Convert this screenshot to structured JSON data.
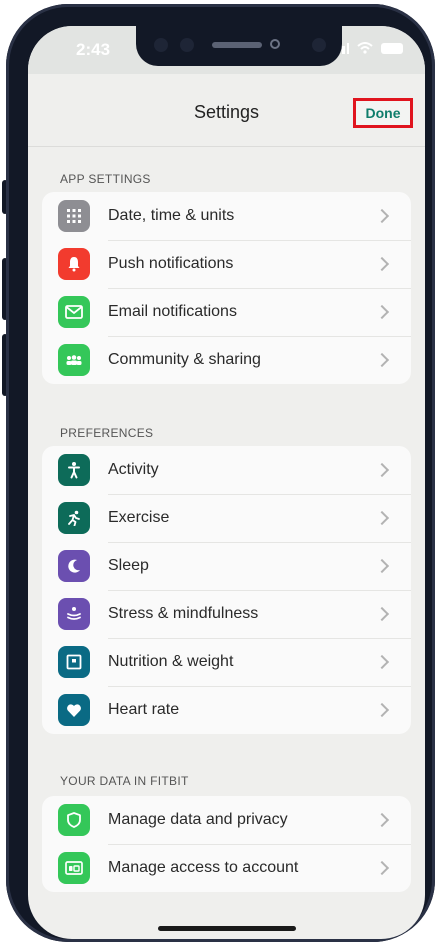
{
  "status_bar": {
    "time": "2:43"
  },
  "nav": {
    "title": "Settings",
    "done_label": "Done"
  },
  "colors": {
    "accent": "#0f7d6b",
    "highlight_border": "#e0141e",
    "grey_icon": "#8e8e93",
    "red_icon": "#f23b2e",
    "green_icon": "#34c759",
    "dark_teal_icon": "#0d6b59",
    "purple_icon": "#6b4fb0",
    "blue_teal_icon": "#0a6a84"
  },
  "sections": [
    {
      "header": "APP SETTINGS",
      "items": [
        {
          "label": "Date, time & units",
          "icon": "calendar-grid-icon",
          "color": "#8e8e93"
        },
        {
          "label": "Push notifications",
          "icon": "bell-icon",
          "color": "#f23b2e"
        },
        {
          "label": "Email notifications",
          "icon": "envelope-icon",
          "color": "#34c759"
        },
        {
          "label": "Community & sharing",
          "icon": "people-icon",
          "color": "#34c759"
        }
      ]
    },
    {
      "header": "PREFERENCES",
      "items": [
        {
          "label": "Activity",
          "icon": "person-standing-icon",
          "color": "#0d6b59"
        },
        {
          "label": "Exercise",
          "icon": "running-icon",
          "color": "#0d6b59"
        },
        {
          "label": "Sleep",
          "icon": "moon-icon",
          "color": "#6b4fb0"
        },
        {
          "label": "Stress & mindfulness",
          "icon": "mindfulness-icon",
          "color": "#6b4fb0"
        },
        {
          "label": "Nutrition & weight",
          "icon": "scale-icon",
          "color": "#0a6a84"
        },
        {
          "label": "Heart rate",
          "icon": "heart-icon",
          "color": "#0a6a84"
        }
      ]
    },
    {
      "header": "YOUR DATA IN FITBIT",
      "items": [
        {
          "label": "Manage data and privacy",
          "icon": "shield-icon",
          "color": "#34c759"
        },
        {
          "label": "Manage access to account",
          "icon": "account-access-icon",
          "color": "#34c759"
        }
      ]
    }
  ]
}
